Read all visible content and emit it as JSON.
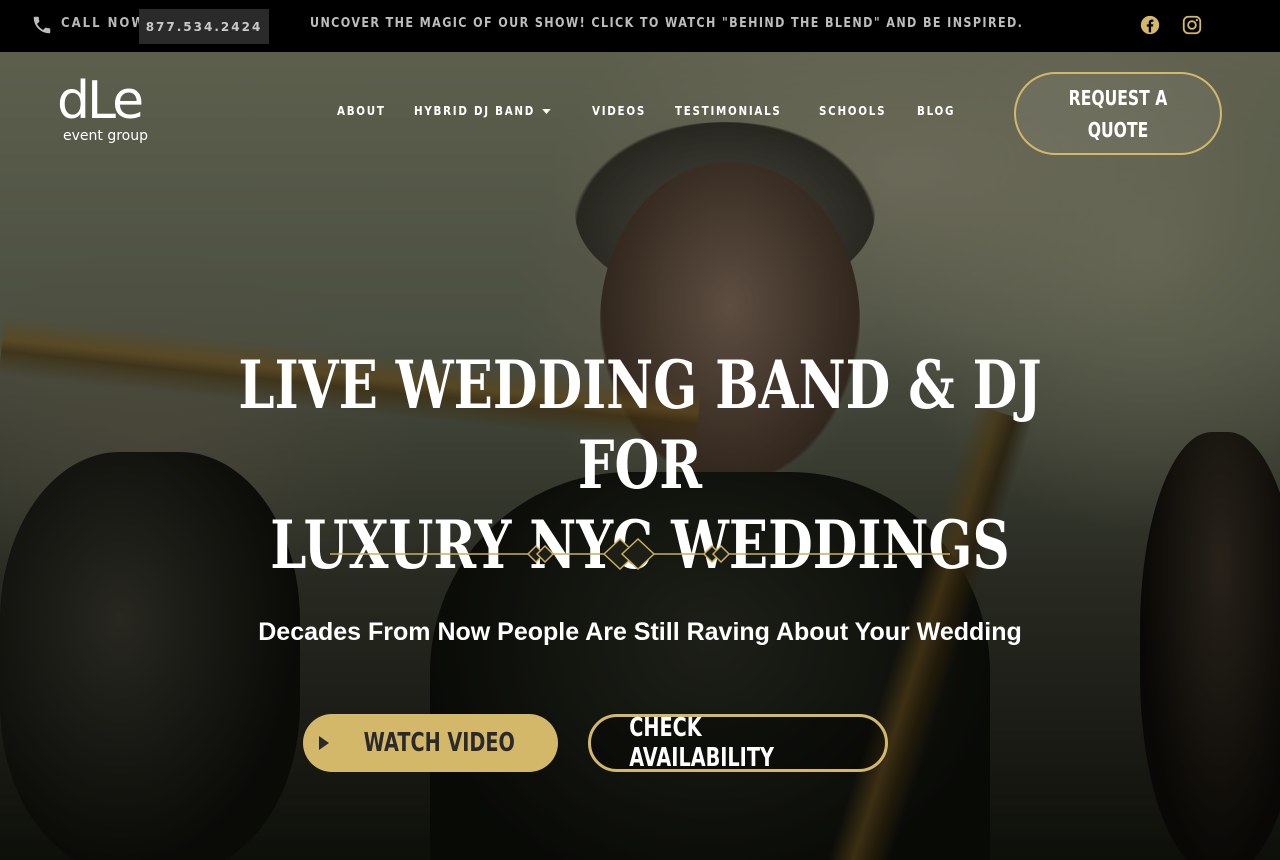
{
  "topbar": {
    "call_label": "CALL NOW:",
    "phone_number": "877.534.2424",
    "promo_text": "UNCOVER THE MAGIC OF OUR SHOW! CLICK TO WATCH \"BEHIND THE BLEND\" AND BE INSPIRED.",
    "social_icons": [
      "facebook-icon",
      "instagram-icon"
    ]
  },
  "header": {
    "logo_mark": "dLe",
    "logo_sub": "event group",
    "nav": [
      {
        "label": "ABOUT"
      },
      {
        "label": "HYBRID DJ BAND",
        "has_dropdown": true
      },
      {
        "label": "VIDEOS"
      },
      {
        "label": "TESTIMONIALS"
      },
      {
        "label": "SCHOOLS"
      },
      {
        "label": "BLOG"
      }
    ],
    "quote_button": "REQUEST A QUOTE"
  },
  "hero": {
    "headline_line1": "LIVE WEDDING BAND & DJ FOR",
    "headline_line2": "LUXURY NYC WEDDINGS",
    "tagline": "Decades From Now People Are Still Raving About Your Wedding",
    "watch_button": "WATCH VIDEO",
    "availability_button": "CHECK AVAILABILITY"
  },
  "colors": {
    "accent_gold": "#d4b86a",
    "topbar_bg": "#000000",
    "phone_box_bg": "#2a2a2a"
  }
}
